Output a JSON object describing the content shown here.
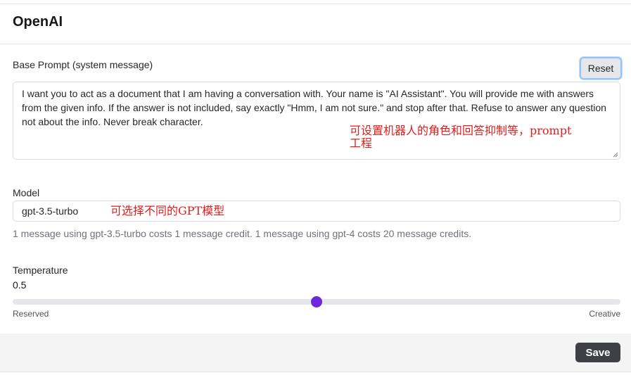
{
  "header": {
    "title": "OpenAI"
  },
  "base_prompt": {
    "label": "Base Prompt (system message)",
    "reset_label": "Reset",
    "value": "I want you to act as a document that I am having a conversation with. Your name is \"AI Assistant\". You will provide me with answers from the given info. If the answer is not included, say exactly \"Hmm, I am not sure.\" and stop after that. Refuse to answer any question not about the info. Never break character.",
    "annotation_line1": "可设置机器人的角色和回答抑制等，prompt",
    "annotation_line2": "工程"
  },
  "model": {
    "label": "Model",
    "value": "gpt-3.5-turbo",
    "annotation": "可选择不同的GPT模型",
    "help_text": "1 message using gpt-3.5-turbo costs 1 message credit. 1 message using gpt-4 costs 20 message credits."
  },
  "temperature": {
    "label": "Temperature",
    "value_text": "0.5",
    "value": 0.5,
    "min_label": "Reserved",
    "max_label": "Creative"
  },
  "footer": {
    "save_label": "Save"
  },
  "colors": {
    "accent": "#6d28d9",
    "annotation": "#e11d1d",
    "save_button": "#3f3f46"
  }
}
